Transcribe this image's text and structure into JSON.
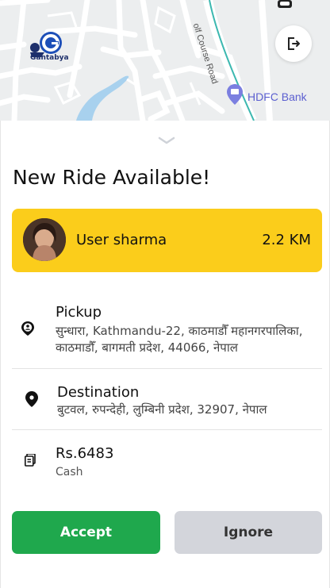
{
  "map": {
    "road_label": "olf Course Road",
    "poi_label": "HDFC Bank",
    "brand_name": "Gantabya"
  },
  "icons": {
    "logout": "logout-icon",
    "handle": "chevron-down-icon",
    "pickup": "location-person-icon",
    "destination": "map-pin-icon",
    "fare": "money-icon"
  },
  "sheet": {
    "title": "New Ride Available!",
    "user": {
      "name": "User sharma",
      "distance": "2.2 KM"
    },
    "pickup": {
      "label": "Pickup",
      "line1": "सुन्धारा, Kathmandu-22, काठमाडौँ महानगरपालिका,",
      "line2": "काठमाडौँ, बागमती प्रदेश, 44066, नेपाल"
    },
    "destination": {
      "label": "Destination",
      "address": "बुटवल, रुपन्देही, लुम्बिनी प्रदेश, 32907, नेपाल"
    },
    "fare": {
      "amount": "Rs.6483",
      "method": "Cash"
    },
    "actions": {
      "accept": "Accept",
      "ignore": "Ignore"
    }
  },
  "colors": {
    "card": "#fbcd1b",
    "accept": "#1fa84d",
    "ignore": "#d3d5db"
  }
}
